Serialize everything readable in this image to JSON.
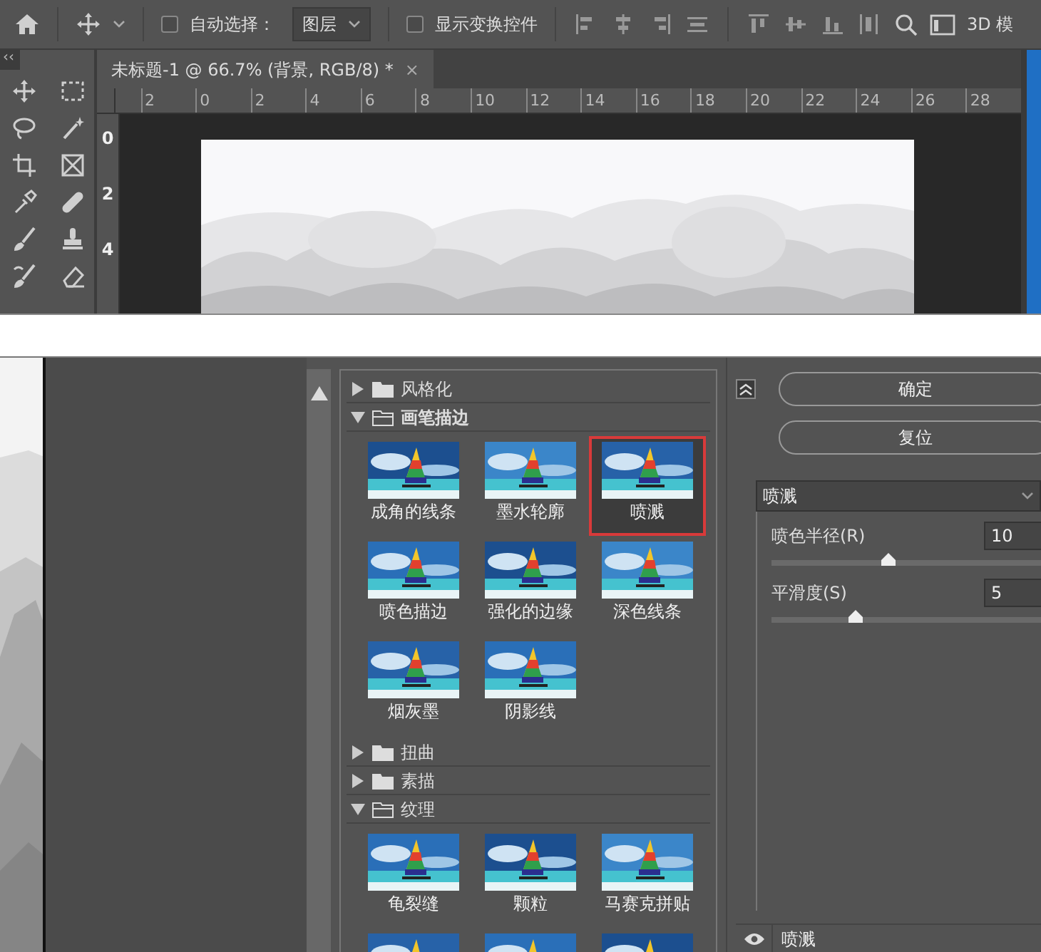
{
  "toolbar": {
    "auto_select": {
      "label": "自动选择：",
      "checked": false
    },
    "layer_select": {
      "value": "图层"
    },
    "transform_controls": {
      "label": "显示变换控件",
      "checked": false
    },
    "mode_label": "3D 模"
  },
  "tools_panel": {
    "collapse": "‹‹"
  },
  "document_tab": {
    "title": "未标题-1 @ 66.7% (背景, RGB/8) *",
    "close": "×"
  },
  "rulers": {
    "horizontal": [
      "2",
      "0",
      "2",
      "4",
      "6",
      "8",
      "10",
      "12",
      "14",
      "16",
      "18",
      "20",
      "22",
      "24",
      "26",
      "28"
    ],
    "vertical": [
      "0",
      "2",
      "4"
    ]
  },
  "filter_gallery": {
    "groups": [
      {
        "name": "风格化",
        "expanded": false
      },
      {
        "name": "画笔描边",
        "expanded": true,
        "filters": [
          {
            "name": "成角的线条",
            "selected": false
          },
          {
            "name": "墨水轮廓",
            "selected": false
          },
          {
            "name": "喷溅",
            "selected": true
          },
          {
            "name": "喷色描边",
            "selected": false
          },
          {
            "name": "强化的边缘",
            "selected": false
          },
          {
            "name": "深色线条",
            "selected": false
          },
          {
            "name": "烟灰墨",
            "selected": false
          },
          {
            "name": "阴影线",
            "selected": false
          }
        ]
      },
      {
        "name": "扭曲",
        "expanded": false
      },
      {
        "name": "素描",
        "expanded": false
      },
      {
        "name": "纹理",
        "expanded": true,
        "filters": [
          {
            "name": "龟裂缝",
            "selected": false
          },
          {
            "name": "颗粒",
            "selected": false
          },
          {
            "name": "马赛克拼贴",
            "selected": false
          },
          {
            "selected": false
          },
          {
            "selected": false
          },
          {
            "selected": false
          }
        ]
      }
    ]
  },
  "settings": {
    "buttons": [
      "确定",
      "复位"
    ],
    "filter_select": "喷溅",
    "sliders": [
      {
        "label": "喷色半径(R)",
        "value": "10",
        "level": 0.4
      },
      {
        "label": "平滑度(S)",
        "value": "5",
        "level": 0.29
      }
    ]
  },
  "effect_layers": [
    {
      "name": "喷溅",
      "visible": true
    }
  ]
}
